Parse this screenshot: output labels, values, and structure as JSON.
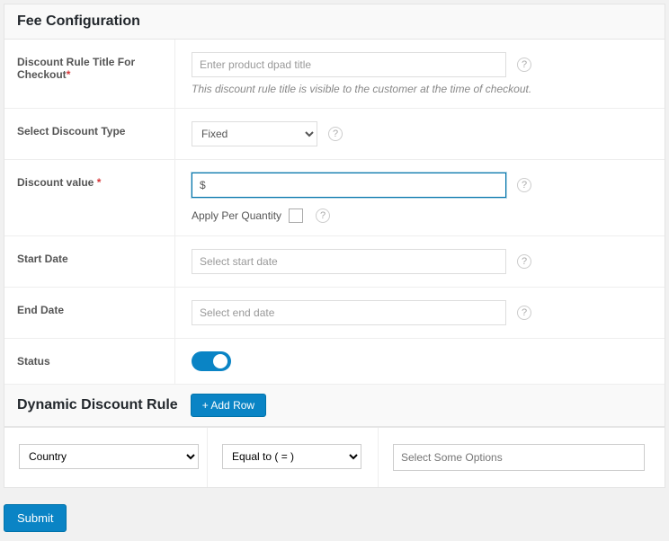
{
  "section1_title": "Fee Configuration",
  "section2_title": "Dynamic Discount Rule",
  "labels": {
    "rule_title": "Discount Rule Title For Checkout",
    "discount_type": "Select Discount Type",
    "discount_value": "Discount value",
    "start_date": "Start Date",
    "end_date": "End Date",
    "status": "Status",
    "apply_per_qty": "Apply Per Quantity"
  },
  "placeholders": {
    "rule_title": "Enter product dpad title",
    "start_date": "Select start date",
    "end_date": "Select end date",
    "multi": "Select Some Options"
  },
  "values": {
    "discount_type_selected": "Fixed",
    "discount_value": "$",
    "rule_condition_field": "Country",
    "rule_condition_op": "Equal to ( = )"
  },
  "help": {
    "rule_title": "This discount rule title is visible to the customer at the time of checkout."
  },
  "buttons": {
    "add_row": "+ Add Row",
    "submit": "Submit"
  },
  "required_marker": "*",
  "help_glyph": "?"
}
